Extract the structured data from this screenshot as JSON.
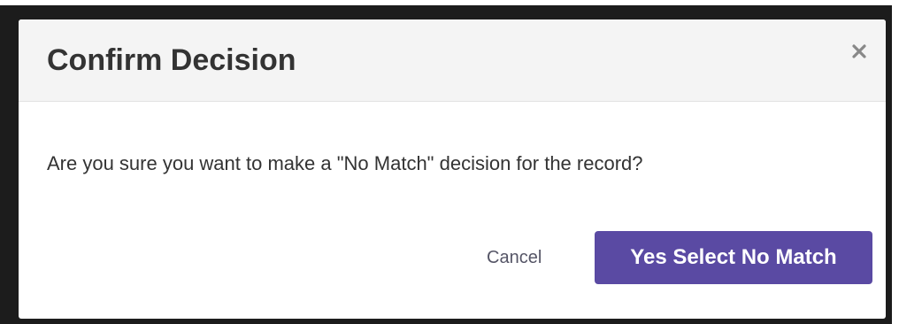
{
  "dialog": {
    "title": "Confirm Decision",
    "close_icon": "close-icon",
    "message": "Are you sure you want to make a \"No Match\" decision for the record?",
    "cancel_label": "Cancel",
    "confirm_label": "Yes Select No Match"
  },
  "colors": {
    "backdrop": "#1c1c1c",
    "header_bg": "#f4f4f4",
    "primary_button": "#5a4aa3",
    "text": "#333333"
  }
}
